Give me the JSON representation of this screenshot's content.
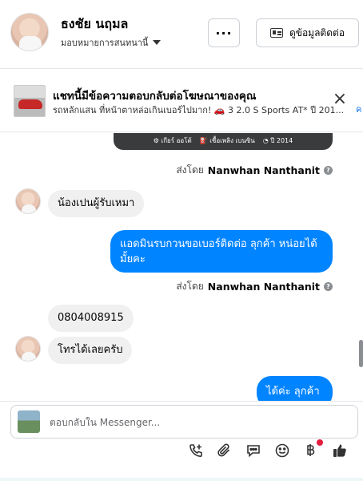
{
  "header": {
    "contact_name": "ธงชัย นฤมล",
    "assigned_to": "มอบหมายการสนทนานี้",
    "more_label": "···",
    "contact_info_label": "ดูข้อมูลติดต่อ"
  },
  "ad_banner": {
    "title": "แชทนี้มีข้อความตอบกลับต่อโฆษณาของคุณ",
    "subtitle": "รถหลักแสน ที่หน้าตาหล่อเกินเบอร์ไปมาก! 🚗 3 2.0 S Sports AT* ปี 201...",
    "close_label": "×",
    "edge_char": "ค"
  },
  "chat": {
    "media_caption_items": [
      "⚙ เกียร์ ออโต้",
      "⛽ เชื้อเพลิง เบนซิน",
      "◔ ปี 2014"
    ],
    "sent_by_prefix": "ส่งโดย",
    "sent_by_name": "Nanwhan Nanthanit",
    "help_label": "?",
    "messages": [
      {
        "direction": "in",
        "text": "น้องเปนผู้รับเหมา"
      },
      {
        "direction": "out",
        "text": "แอดมินรบกวนขอเบอร์ติดต่อ ลุกค้า  หน่อยได้มั้ยคะ"
      },
      {
        "direction": "in",
        "text": "0804008915"
      },
      {
        "direction": "in",
        "text": "โทรได้เลยครับ"
      },
      {
        "direction": "out",
        "text": "ได้ค่ะ ลุกค้า"
      }
    ]
  },
  "composer": {
    "placeholder": "ตอบกลับใน Messenger...",
    "tools": [
      "call-add-icon",
      "paperclip-icon",
      "saved-reply-icon",
      "emoji-icon",
      "baht-icon",
      "thumbs-up-icon"
    ]
  },
  "colors": {
    "accent": "#0084ff",
    "incoming_bubble": "#f0f0f0",
    "badge": "#e41e3f"
  }
}
